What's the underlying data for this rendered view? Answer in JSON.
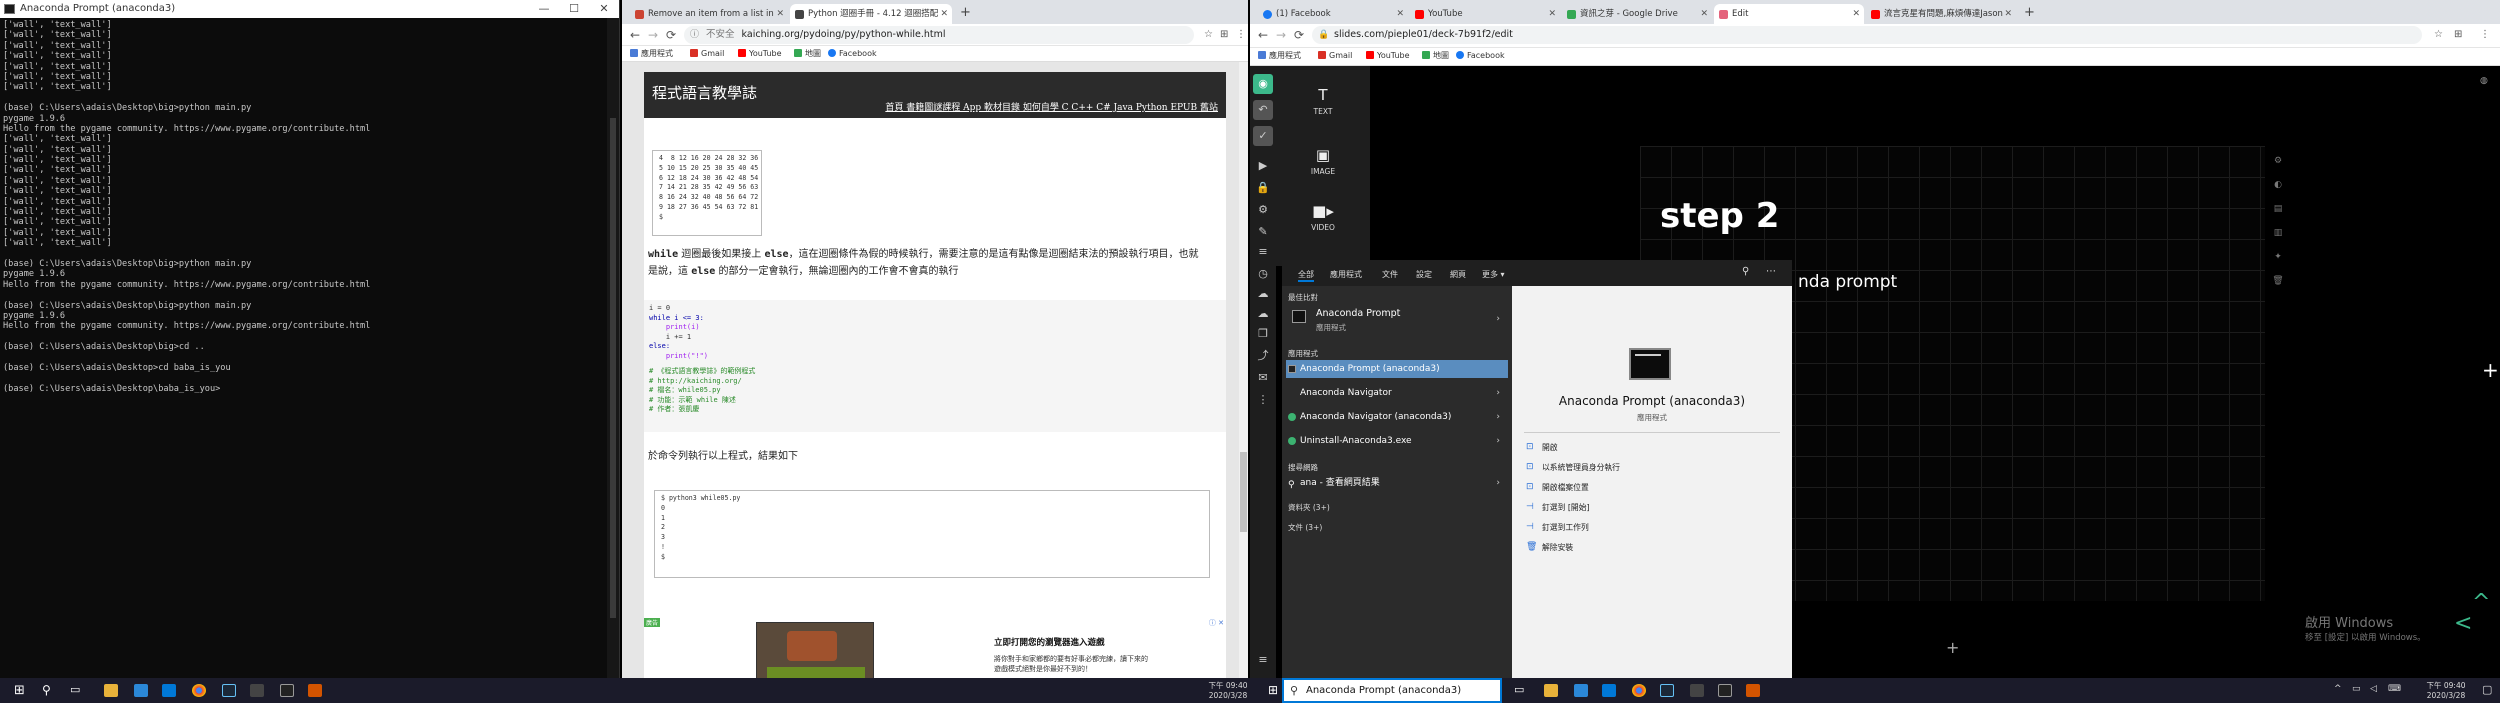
{
  "terminal": {
    "title": "Anaconda Prompt (anaconda3)",
    "win_min": "—",
    "win_max": "☐",
    "win_close": "✕",
    "lines": [
      "['wall', 'text_wall']",
      "['wall', 'text_wall']",
      "['wall', 'text_wall']",
      "['wall', 'text_wall']",
      "['wall', 'text_wall']",
      "['wall', 'text_wall']",
      "['wall', 'text_wall']",
      "",
      "(base) C:\\Users\\adais\\Desktop\\big>python main.py",
      "pygame 1.9.6",
      "Hello from the pygame community. https://www.pygame.org/contribute.html",
      "['wall', 'text_wall']",
      "['wall', 'text_wall']",
      "['wall', 'text_wall']",
      "['wall', 'text_wall']",
      "['wall', 'text_wall']",
      "['wall', 'text_wall']",
      "['wall', 'text_wall']",
      "['wall', 'text_wall']",
      "['wall', 'text_wall']",
      "['wall', 'text_wall']",
      "['wall', 'text_wall']",
      "",
      "(base) C:\\Users\\adais\\Desktop\\big>python main.py",
      "pygame 1.9.6",
      "Hello from the pygame community. https://www.pygame.org/contribute.html",
      "",
      "(base) C:\\Users\\adais\\Desktop\\big>python main.py",
      "pygame 1.9.6",
      "Hello from the pygame community. https://www.pygame.org/contribute.html",
      "",
      "(base) C:\\Users\\adais\\Desktop\\big>cd ..",
      "",
      "(base) C:\\Users\\adais\\Desktop>cd baba_is_you",
      "",
      "(base) C:\\Users\\adais\\Desktop\\baba_is_you>"
    ]
  },
  "browser1": {
    "tabs": [
      {
        "label": "Remove an item from a list in"
      },
      {
        "label": "Python 迴圈手冊 - 4.12 迴圈搭配"
      }
    ],
    "back": "←",
    "forward": "→",
    "reload": "⟳",
    "insecure": "不安全",
    "url": "kaiching.org/pydoing/py/python-while.html",
    "bookmarks": [
      "應用程式",
      "Gmail",
      "YouTube",
      "地圖",
      "Facebook"
    ],
    "site_title": "程式語言教學誌",
    "site_nav": "首頁 書籍圖謎課程 App 軟材目錄 如何自學 C C++ C# Java Python EPUB 舊站",
    "table_output": "4  8 12 16 20 24 28 32 36\n5 10 15 20 25 30 35 40 45\n6 12 18 24 30 36 42 48 54\n7 14 21 28 35 42 49 56 63\n8 16 24 32 40 48 56 64 72\n9 18 27 36 45 54 63 72 81\n$",
    "para1_a": "while",
    "para1_b": " 迴圈最後如果接上 ",
    "para1_c": "else",
    "para1_d": "，這在迴圈條件為假的時候執行，需要注意的是這有點像是迴圈結束法的預設執行項目，也就是說，這 ",
    "para1_e": "else",
    "para1_f": " 的部分一定會執行，無論迴圈內的工作會不會真的執行",
    "code": {
      "l1": "i = 0",
      "l2": "while i <= 3:",
      "l3": "    print(i)",
      "l4": "    i += 1",
      "l5": "else:",
      "l6": "    print(\"!\")",
      "c1": "# 《程式語言教學誌》的範例程式",
      "c2": "# http://kaiching.org/",
      "c3": "# 檔名：while05.py",
      "c3b": "# 功能：示範 while 陳述",
      "c4": "# 作者：張凱慶"
    },
    "para2": "於命令列執行以上程式，結果如下",
    "output2": "$ python3 while05.py\n0\n1\n2\n3\n!\n$",
    "ad_label": "廣告",
    "ad_close": "ⓘ ✕",
    "ad_title": "立即打開您的瀏覽器進入遊戲",
    "ad_text": "將你對手和家鄉都的要有好事必都完練，讀下來的遊戲模式絕對是你最好不到的！"
  },
  "browser2": {
    "tabs": [
      {
        "label": "(1) Facebook"
      },
      {
        "label": "YouTube"
      },
      {
        "label": "資訊之芽 - Google Drive"
      },
      {
        "label": "Edit"
      },
      {
        "label": "流言克星有問題,麻煩傳達Jason"
      }
    ],
    "url": "slides.com/pieple01/deck-7b91f2/edit",
    "bookmarks": [
      "應用程式",
      "Gmail",
      "YouTube",
      "地圖",
      "Facebook"
    ],
    "panel": [
      {
        "icon": "T",
        "label": "TEXT"
      },
      {
        "icon": "▣",
        "label": "IMAGE"
      },
      {
        "icon": "■▸",
        "label": "VIDEO"
      }
    ],
    "slide_title": "step 2",
    "slide_sub": "nda prompt",
    "plus": "+",
    "watermark_title": "啟用 Windows",
    "watermark_sub": "移至 [設定] 以啟用 Windows。"
  },
  "startmenu": {
    "tabs": [
      "全部",
      "應用程式",
      "文件",
      "設定",
      "網頁",
      "更多 ▾"
    ],
    "best_header": "最佳比對",
    "best_title": "Anaconda Prompt",
    "best_sub": "應用程式",
    "apps_header": "應用程式",
    "apps": [
      {
        "label": "Anaconda Prompt (anaconda3)",
        "selected": true
      },
      {
        "label": "Anaconda Navigator",
        "selected": false
      },
      {
        "label": "Anaconda Navigator (anaconda3)",
        "selected": false
      },
      {
        "label": "Uninstall-Anaconda3.exe",
        "selected": false
      }
    ],
    "web_header": "搜尋網路",
    "web_item": "ana - 查看網頁結果",
    "folders": "資料夾 (3+)",
    "docs": "文件 (3+)",
    "right_title": "Anaconda Prompt (anaconda3)",
    "right_sub": "應用程式",
    "actions": [
      "開啟",
      "以系統管理員身分執行",
      "開啟檔案位置",
      "釘選到 [開始]",
      "釘選到工作列",
      "解除安裝"
    ],
    "search_value": "Anaconda Prompt (anaconda3)"
  },
  "taskbar_left": {
    "time": "下午 09:40",
    "date": "2020/3/28"
  },
  "taskbar_right": {
    "time": "下午 09:40",
    "date": "2020/3/28"
  }
}
